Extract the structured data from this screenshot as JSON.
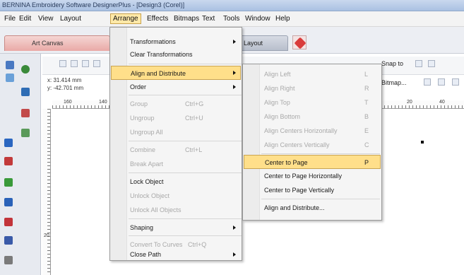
{
  "window": {
    "title": "BERNINA Embroidery Software DesignerPlus - [Design3 (Corel)]"
  },
  "menubar": [
    "File",
    "Edit",
    "View",
    "Layout",
    "Arrange",
    "Effects",
    "Bitmaps",
    "Text",
    "Tools",
    "Window",
    "Help"
  ],
  "tabs": {
    "art_canvas": "Art Canvas",
    "layout": "Layout"
  },
  "coords": {
    "x": "x: 31.414 mm",
    "y": "y: -42.701 mm"
  },
  "toolbar_right": {
    "snap": "Snap to",
    "bitmap": "Bitmap..."
  },
  "ruler": {
    "h1": "160",
    "h2": "140",
    "h3": "20",
    "h4": "40",
    "v1": "20"
  },
  "arrange_menu": [
    {
      "label": "Transformations",
      "shortcut": "",
      "submenu": true,
      "enabled": true
    },
    {
      "label": "Clear Transformations",
      "shortcut": "",
      "submenu": false,
      "enabled": true
    },
    {
      "label": "Align and Distribute",
      "shortcut": "",
      "submenu": true,
      "enabled": true,
      "highlighted": true
    },
    {
      "label": "Order",
      "shortcut": "",
      "submenu": true,
      "enabled": true
    },
    {
      "label": "Group",
      "shortcut": "Ctrl+G",
      "submenu": false,
      "enabled": false
    },
    {
      "label": "Ungroup",
      "shortcut": "Ctrl+U",
      "submenu": false,
      "enabled": false
    },
    {
      "label": "Ungroup All",
      "shortcut": "",
      "submenu": false,
      "enabled": false
    },
    {
      "label": "Combine",
      "shortcut": "Ctrl+L",
      "submenu": false,
      "enabled": false
    },
    {
      "label": "Break Apart",
      "shortcut": "",
      "submenu": false,
      "enabled": false
    },
    {
      "label": "Lock Object",
      "shortcut": "",
      "submenu": false,
      "enabled": true
    },
    {
      "label": "Unlock Object",
      "shortcut": "",
      "submenu": false,
      "enabled": false
    },
    {
      "label": "Unlock All Objects",
      "shortcut": "",
      "submenu": false,
      "enabled": false
    },
    {
      "label": "Shaping",
      "shortcut": "",
      "submenu": true,
      "enabled": true
    },
    {
      "label": "Convert To Curves",
      "shortcut": "Ctrl+Q",
      "submenu": false,
      "enabled": false
    },
    {
      "label": "Close Path",
      "shortcut": "",
      "submenu": true,
      "enabled": true
    }
  ],
  "align_menu": [
    {
      "label": "Align Left",
      "shortcut": "L",
      "enabled": false
    },
    {
      "label": "Align Right",
      "shortcut": "R",
      "enabled": false
    },
    {
      "label": "Align Top",
      "shortcut": "T",
      "enabled": false
    },
    {
      "label": "Align Bottom",
      "shortcut": "B",
      "enabled": false
    },
    {
      "label": "Align Centers Horizontally",
      "shortcut": "E",
      "enabled": false
    },
    {
      "label": "Align Centers Vertically",
      "shortcut": "C",
      "enabled": false
    },
    {
      "label": "Center to Page",
      "shortcut": "P",
      "enabled": true,
      "highlighted": true
    },
    {
      "label": "Center to Page Horizontally",
      "shortcut": "",
      "enabled": true
    },
    {
      "label": "Center to Page Vertically",
      "shortcut": "",
      "enabled": true
    },
    {
      "label": "Align and Distribute...",
      "shortcut": "",
      "enabled": true
    }
  ]
}
